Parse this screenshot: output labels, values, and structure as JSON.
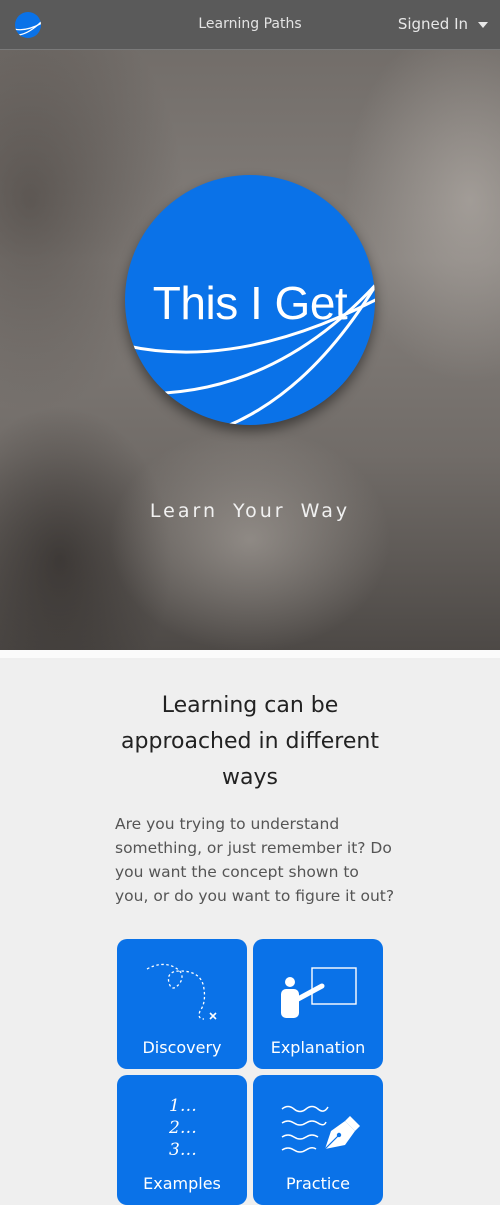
{
  "topbar": {
    "logo_icon": "globe-swoosh-icon",
    "nav_label": "Learning Paths",
    "account_label": "Signed In",
    "account_icon": "chevron-down-icon"
  },
  "hero": {
    "logo_text": "This I Get",
    "tagline": "Learn Your Way",
    "brand_color": "#0a72e8"
  },
  "intro": {
    "heading": "Learning can be approached in different ways",
    "body": "Are you trying to understand something, or just remember it? Do you want the concept shown to you, or do you want to figure it out?"
  },
  "tiles": [
    {
      "label": "Discovery",
      "icon": "dotted-path-icon"
    },
    {
      "label": "Explanation",
      "icon": "presenter-board-icon"
    },
    {
      "label": "Examples",
      "icon": "numbered-list-icon"
    },
    {
      "label": "Practice",
      "icon": "pen-writing-icon"
    }
  ],
  "examples_icon_text": [
    "1…",
    "2…",
    "3…"
  ]
}
